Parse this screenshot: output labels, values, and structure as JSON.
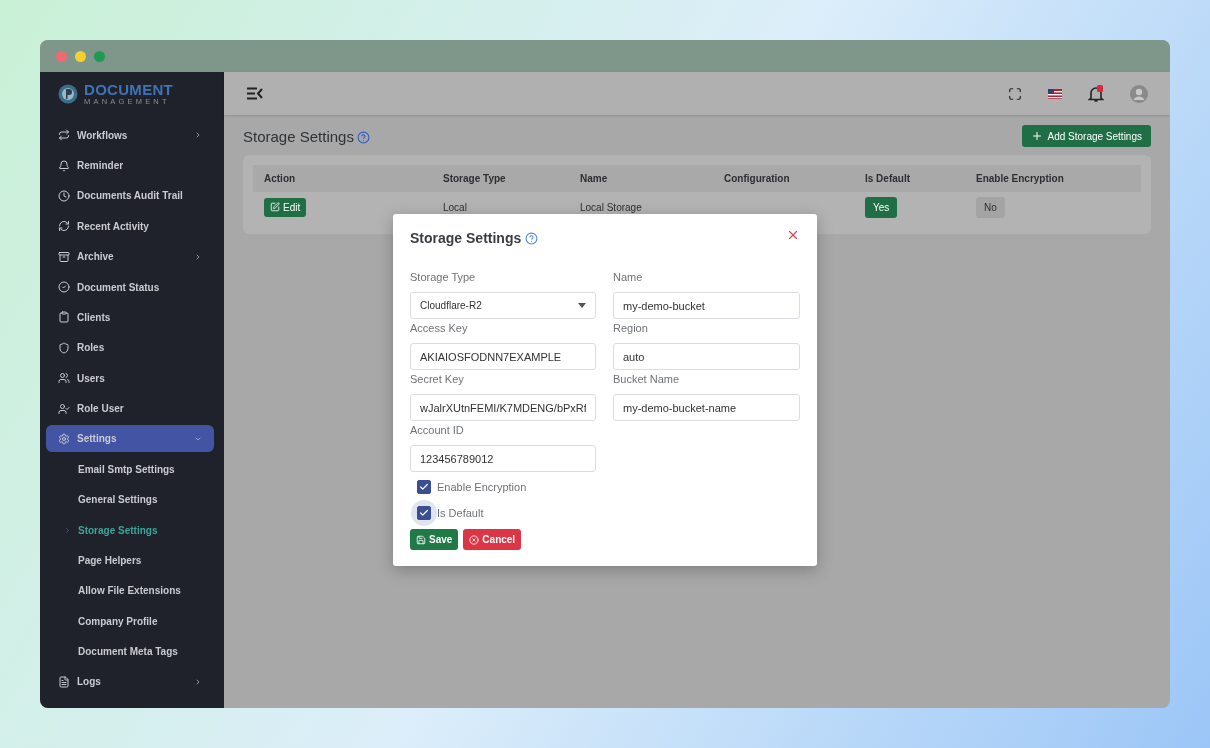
{
  "brand": {
    "title": "DOCUMENT",
    "subtitle": "MANAGEMENT"
  },
  "sidebar": {
    "items": [
      {
        "label": "Workflows",
        "has_submenu": true,
        "selected": false
      },
      {
        "label": "Reminder",
        "has_submenu": false,
        "selected": false
      },
      {
        "label": "Documents Audit Trail",
        "has_submenu": false,
        "selected": false
      },
      {
        "label": "Recent Activity",
        "has_submenu": false,
        "selected": false
      },
      {
        "label": "Archive",
        "has_submenu": true,
        "selected": false
      },
      {
        "label": "Document Status",
        "has_submenu": false,
        "selected": false
      },
      {
        "label": "Clients",
        "has_submenu": false,
        "selected": false
      },
      {
        "label": "Roles",
        "has_submenu": false,
        "selected": false
      },
      {
        "label": "Users",
        "has_submenu": false,
        "selected": false
      },
      {
        "label": "Role User",
        "has_submenu": false,
        "selected": false
      },
      {
        "label": "Settings",
        "has_submenu": true,
        "selected": true,
        "expanded": true,
        "children": [
          {
            "label": "Email Smtp Settings",
            "selected": false
          },
          {
            "label": "General Settings",
            "selected": false
          },
          {
            "label": "Storage Settings",
            "selected": true
          },
          {
            "label": "Page Helpers",
            "selected": false
          },
          {
            "label": "Allow File Extensions",
            "selected": false
          },
          {
            "label": "Company Profile",
            "selected": false
          },
          {
            "label": "Document Meta Tags",
            "selected": false
          }
        ]
      },
      {
        "label": "Logs",
        "has_submenu": true,
        "selected": false
      }
    ]
  },
  "page": {
    "title": "Storage Settings",
    "add_button": "Add Storage Settings"
  },
  "table": {
    "columns": [
      "Action",
      "Storage Type",
      "Name",
      "Configuration",
      "Is Default",
      "Enable Encryption"
    ],
    "rows": [
      {
        "action": "Edit",
        "storage_type": "Local",
        "name": "Local Storage",
        "is_default": "Yes",
        "enable_encryption": "No"
      }
    ]
  },
  "dialog": {
    "title": "Storage Settings",
    "fields": [
      {
        "label": "Storage Type",
        "value": "Cloudflare-R2",
        "kind": "select"
      },
      {
        "label": "Name",
        "value": "my-demo-bucket",
        "kind": "text"
      },
      {
        "label": "Access Key",
        "value": "AKIAIOSFODNN7EXAMPLE",
        "kind": "text"
      },
      {
        "label": "Region",
        "value": "auto",
        "kind": "text"
      },
      {
        "label": "Secret Key",
        "value": "wJalrXUtnFEMI/K7MDENG/bPxRf",
        "kind": "text"
      },
      {
        "label": "Bucket Name",
        "value": "my-demo-bucket-name",
        "kind": "text"
      },
      {
        "label": "Account ID",
        "value": "123456789012",
        "kind": "text"
      }
    ],
    "checkboxes": [
      {
        "label": "Enable Encryption",
        "checked": true,
        "focused": false
      },
      {
        "label": "Is Default",
        "checked": true,
        "focused": true
      }
    ],
    "buttons": [
      {
        "label": "Save",
        "kind": "save"
      },
      {
        "label": "Cancel",
        "kind": "cancel"
      }
    ]
  }
}
